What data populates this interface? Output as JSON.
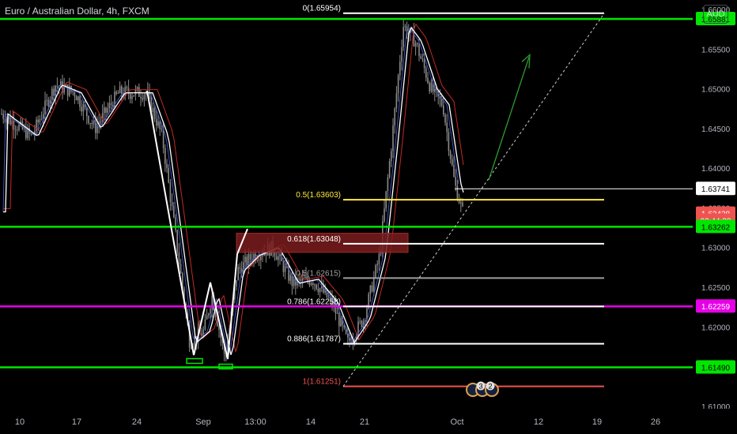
{
  "header": {
    "symbol_title": "Euro / Australian Dollar, 4h, FXCM",
    "currency": "AUD"
  },
  "colors": {
    "background": "#000000",
    "green_line": "#00e600",
    "magenta_line": "#e600e6",
    "ma_white": "#ffffff",
    "ma_red": "#c62828",
    "ma_blue": "#3f51b5",
    "candle": "#8a8a8a",
    "zone": "#7a1c1c",
    "yellow_fib": "#ffeb3b",
    "red_fib": "#ef5350",
    "gray_fib": "#9e9e9e",
    "arrow": "#2e9d2e"
  },
  "chart_data": {
    "type": "candlestick",
    "title": "Euro / Australian Dollar, 4h, FXCM",
    "y_axis": {
      "range": [
        1.6065,
        1.6612
      ],
      "tick_labels": [
        "1.66000",
        "1.65500",
        "1.65000",
        "1.64500",
        "1.64000",
        "1.63500",
        "1.63000",
        "1.62500",
        "1.62000",
        "1.61500",
        "1.61000"
      ],
      "tick_values": [
        1.66,
        1.655,
        1.65,
        1.645,
        1.64,
        1.635,
        1.63,
        1.625,
        1.62,
        1.615,
        1.61
      ]
    },
    "x_axis": {
      "tick_labels": [
        "10",
        "17",
        "24",
        "Sep",
        "13:00",
        "14",
        "21",
        "Oct",
        "12",
        "19",
        "26"
      ]
    },
    "price_labels": [
      {
        "text": "1.65881",
        "value": 1.65881,
        "color": "#00e600"
      },
      {
        "text": "1.63741",
        "value": 1.63741,
        "color": "#ffffff"
      },
      {
        "text": "1.63428",
        "value": 1.63428,
        "color": "#ef5350"
      },
      {
        "text": "03:44:38",
        "value": 1.6334,
        "color": "#ef5350"
      },
      {
        "text": "1.63262",
        "value": 1.63262,
        "color": "#00e600"
      },
      {
        "text": "1.62259",
        "value": 1.62259,
        "color": "#e600e6"
      },
      {
        "text": "1.61490",
        "value": 1.6149,
        "color": "#00e600"
      }
    ],
    "horizontal_lines": [
      {
        "value": 1.65881,
        "color": "#00e600",
        "name": "resistance-top"
      },
      {
        "value": 1.63262,
        "color": "#00e600",
        "name": "support-mid"
      },
      {
        "value": 1.62259,
        "color": "#e600e6",
        "name": "support-magenta"
      },
      {
        "value": 1.6149,
        "color": "#00e600",
        "name": "support-bottom"
      }
    ],
    "fib_levels": [
      {
        "label": "0(1.65954)",
        "value": 1.65954,
        "color": "#ffffff"
      },
      {
        "label": "0.5(1.63603)",
        "value": 1.63603,
        "color": "#ffeb3b"
      },
      {
        "label": "0.618(1.63048)",
        "value": 1.63048,
        "color": "#ffffff"
      },
      {
        "label": "0.5(1.62615)",
        "value": 1.62615,
        "color": "#9e9e9e"
      },
      {
        "label": "0.786(1.62258)",
        "value": 1.62258,
        "color": "#ffffff"
      },
      {
        "label": "0.886(1.61787)",
        "value": 1.61787,
        "color": "#ffffff"
      },
      {
        "label": "1(1.61251)",
        "value": 1.61251,
        "color": "#ef5350"
      }
    ],
    "resistance_zone": {
      "top": 1.6318,
      "bottom": 1.6294
    },
    "event_badges": [
      "3",
      "2"
    ]
  }
}
